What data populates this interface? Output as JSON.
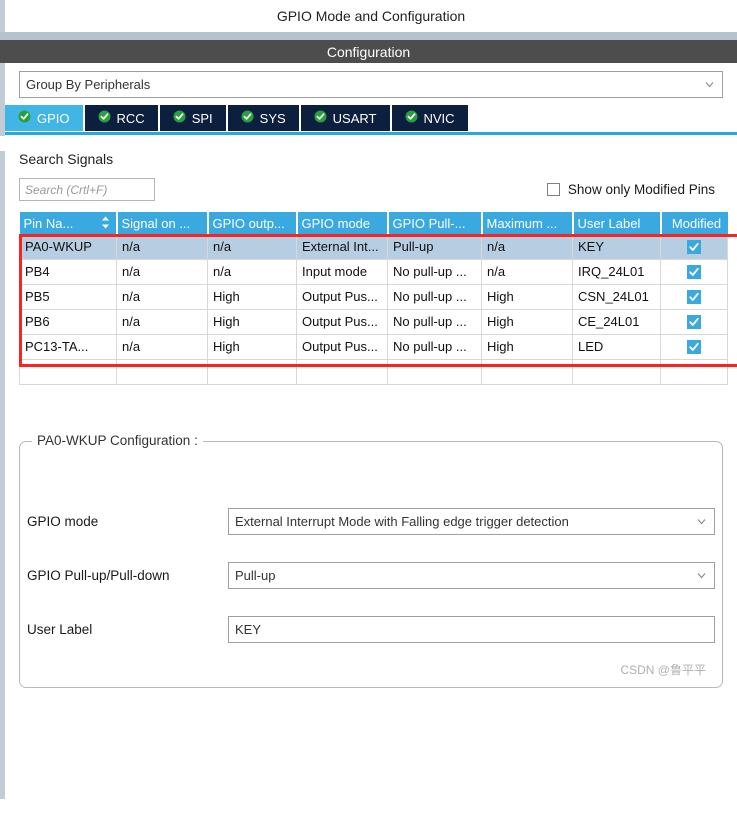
{
  "window": {
    "title": "GPIO Mode and Configuration",
    "config_header": "Configuration"
  },
  "group_by": {
    "value": "Group By Peripherals",
    "icon": "chevron-down-icon"
  },
  "tabs": [
    {
      "label": "GPIO",
      "active": true,
      "icon": "green-check-icon"
    },
    {
      "label": "RCC",
      "active": false,
      "icon": "green-check-icon"
    },
    {
      "label": "SPI",
      "active": false,
      "icon": "green-check-icon"
    },
    {
      "label": "SYS",
      "active": false,
      "icon": "green-check-icon"
    },
    {
      "label": "USART",
      "active": false,
      "icon": "green-check-icon"
    },
    {
      "label": "NVIC",
      "active": false,
      "icon": "green-check-icon"
    }
  ],
  "search": {
    "label": "Search Signals",
    "placeholder": "Search (Crtl+F)",
    "value": ""
  },
  "filter": {
    "show_only_modified_label": "Show only Modified Pins",
    "checked": false
  },
  "table": {
    "columns": [
      "Pin Na...",
      "Signal on ...",
      "GPIO outp...",
      "GPIO mode",
      "GPIO Pull-...",
      "Maximum ...",
      "User Label",
      "Modified"
    ],
    "sort_column": "Pin Na...",
    "rows": [
      {
        "pin": "PA0-WKUP",
        "signal": "n/a",
        "output": "n/a",
        "mode": "External Int...",
        "pull": "Pull-up",
        "maximum": "n/a",
        "user_label": "KEY",
        "modified": true,
        "selected": true
      },
      {
        "pin": "PB4",
        "signal": "n/a",
        "output": "n/a",
        "mode": "Input mode",
        "pull": "No pull-up ...",
        "maximum": "n/a",
        "user_label": "IRQ_24L01",
        "modified": true,
        "selected": false
      },
      {
        "pin": "PB5",
        "signal": "n/a",
        "output": "High",
        "mode": "Output Pus...",
        "pull": "No pull-up ...",
        "maximum": "High",
        "user_label": "CSN_24L01",
        "modified": true,
        "selected": false
      },
      {
        "pin": "PB6",
        "signal": "n/a",
        "output": "High",
        "mode": "Output Pus...",
        "pull": "No pull-up ...",
        "maximum": "High",
        "user_label": "CE_24L01",
        "modified": true,
        "selected": false
      },
      {
        "pin": "PC13-TA...",
        "signal": "n/a",
        "output": "High",
        "mode": "Output Pus...",
        "pull": "No pull-up ...",
        "maximum": "High",
        "user_label": "LED",
        "modified": true,
        "selected": false
      }
    ]
  },
  "pin_config": {
    "legend": "PA0-WKUP Configuration :",
    "fields": [
      {
        "label": "GPIO mode",
        "value": "External Interrupt Mode with Falling edge trigger detection",
        "type": "combo"
      },
      {
        "label": "GPIO Pull-up/Pull-down",
        "value": "Pull-up",
        "type": "combo"
      },
      {
        "label": "User Label",
        "value": "KEY",
        "type": "text"
      }
    ]
  },
  "watermark": "CSDN @鲁平平",
  "colors": {
    "accent_blue": "#3aa9e0",
    "tab_active": "#41b6e6",
    "tab_inactive": "#0c1f3f",
    "header_gray": "#4d4d4d",
    "row_selected": "#b7cee2",
    "annotation_red": "#fb2222",
    "check_green": "#2aa03c"
  }
}
